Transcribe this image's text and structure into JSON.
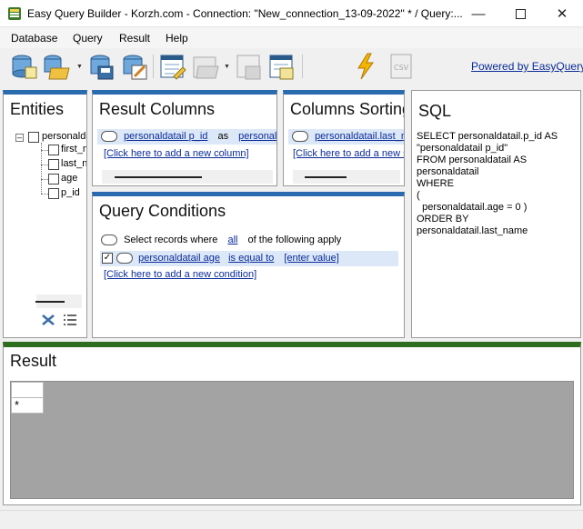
{
  "window": {
    "title": "Easy Query Builder - Korzh.com - Connection: \"New_connection_13-09-2022\" * / Query:..."
  },
  "menu": [
    "Database",
    "Query",
    "Result",
    "Help"
  ],
  "toolbar": {
    "powered_by": "Powered by EasyQuery"
  },
  "entities": {
    "title": "Entities",
    "root": "personaldatail",
    "fields": [
      "first_name",
      "last_name",
      "age",
      "p_id"
    ]
  },
  "result_columns": {
    "title": "Result Columns",
    "column_field": "personaldatail p_id",
    "as_word": "as",
    "column_alias": "personaldatail p_id",
    "add_link": "[Click here to add a new column]"
  },
  "columns_sorting": {
    "title": "Columns Sorting",
    "sort_field": "personaldatail.last_name",
    "add_link": "[Click here to add a new sorting]"
  },
  "sql": {
    "title": "SQL",
    "lines": [
      "SELECT personaldatail.p_id AS",
      "\"personaldatail p_id\"",
      "FROM personaldatail AS",
      "personaldatail",
      "WHERE",
      "(",
      "  personaldatail.age = 0 )",
      "ORDER BY",
      "personaldatail.last_name"
    ]
  },
  "query_conditions": {
    "title": "Query Conditions",
    "select_text": "Select records where",
    "all_link": "all",
    "apply_text": "of the following apply",
    "condition_field": "personaldatail age",
    "condition_operator": "is equal to",
    "condition_value": "[enter value]",
    "add_link": "[Click here to add a new condition]"
  },
  "result": {
    "title": "Result",
    "new_row_marker": "*"
  }
}
